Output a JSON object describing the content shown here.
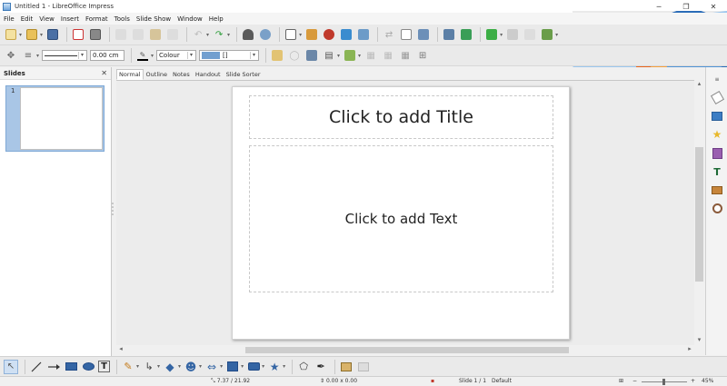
{
  "window": {
    "title": "Untitled 1 - LibreOffice Impress",
    "minimize": "─",
    "maximize": "❐",
    "close": "✕"
  },
  "menu": [
    "File",
    "Edit",
    "View",
    "Insert",
    "Format",
    "Tools",
    "Slide Show",
    "Window",
    "Help"
  ],
  "line_toolbar": {
    "line_width": "0.00 cm",
    "area_style": "Colour",
    "area_color": "[]"
  },
  "slides_pane": {
    "title": "Slides",
    "close": "✕",
    "slides": [
      {
        "number": "1"
      }
    ]
  },
  "view_tabs": [
    "Normal",
    "Outline",
    "Notes",
    "Handout",
    "Slide Sorter"
  ],
  "slide": {
    "title_placeholder": "Click to add Title",
    "text_placeholder": "Click to add Text"
  },
  "statusbar": {
    "position": "7.37 / 21.92",
    "size": "0.00 x 0.00",
    "slide_indicator": "Slide 1 / 1",
    "layout": "Default",
    "zoom_minus": "−",
    "zoom_plus": "+",
    "zoom_percent": "45%"
  },
  "colors": {
    "slide_selected": "#a9c6e6",
    "banner_orange": "#e8641b",
    "banner_blue": "#7fb6e8"
  }
}
